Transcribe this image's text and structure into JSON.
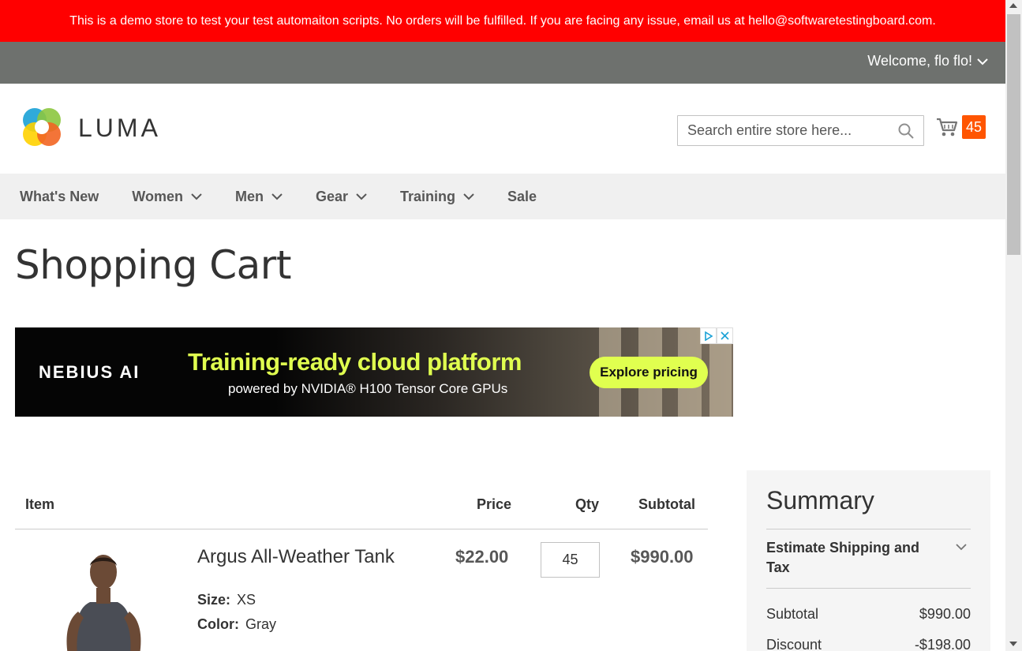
{
  "demo_notice": "This is a demo store to test your test automaiton scripts. No orders will be fulfilled. If you are facing any issue, email us at hello@softwaretestingboard.com.",
  "header": {
    "welcome": "Welcome, flo flo!",
    "logo_text": "LUMA",
    "search": {
      "placeholder": "Search entire store here...",
      "value": ""
    },
    "cart_count": "45"
  },
  "nav": {
    "items": [
      {
        "label": "What's New",
        "has_dropdown": false
      },
      {
        "label": "Women",
        "has_dropdown": true
      },
      {
        "label": "Men",
        "has_dropdown": true
      },
      {
        "label": "Gear",
        "has_dropdown": true
      },
      {
        "label": "Training",
        "has_dropdown": true
      },
      {
        "label": "Sale",
        "has_dropdown": false
      }
    ]
  },
  "page_title": "Shopping Cart",
  "ad": {
    "brand": "NEBIUS AI",
    "headline": "Training-ready cloud platform",
    "subline": "powered by NVIDIA® H100 Tensor Core GPUs",
    "cta": "Explore pricing"
  },
  "cart_table": {
    "headers": {
      "item": "Item",
      "price": "Price",
      "qty": "Qty",
      "subtotal": "Subtotal"
    },
    "rows": [
      {
        "name": "Argus All-Weather Tank",
        "options": [
          {
            "label": "Size:",
            "value": "XS"
          },
          {
            "label": "Color:",
            "value": "Gray"
          }
        ],
        "price": "$22.00",
        "qty": "45",
        "subtotal": "$990.00"
      }
    ]
  },
  "summary": {
    "title": "Summary",
    "estimate_label": "Estimate Shipping and Tax",
    "rows": [
      {
        "label": "Subtotal",
        "value": "$990.00"
      },
      {
        "label": "Discount",
        "value": "-$198.00"
      }
    ]
  },
  "colors": {
    "demo_bar": "#ff0000",
    "top_bar": "#6e716e",
    "cart_badge": "#ff5501",
    "ad_accent": "#e0ff4f"
  }
}
